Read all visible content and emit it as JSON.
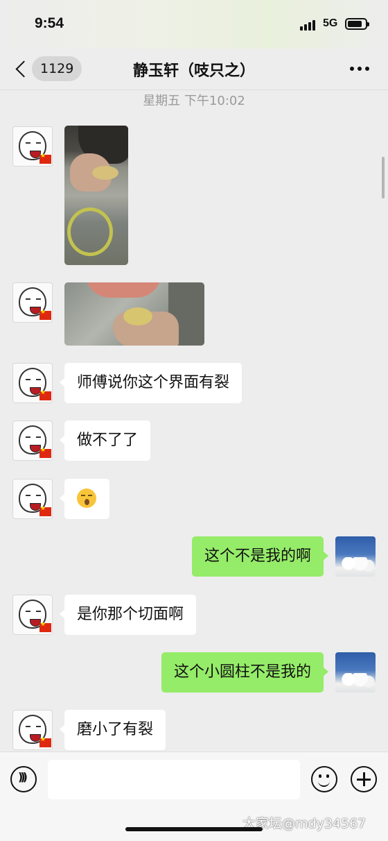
{
  "status_bar": {
    "time": "9:54",
    "network": "5G"
  },
  "nav": {
    "unread_count": "1129",
    "title": "静玉轩（吱只之）",
    "more_icon": "more-dots-icon",
    "back_icon": "chevron-left-icon"
  },
  "chat": {
    "timestamp": "星期五 下午10:02",
    "messages": [
      {
        "side": "left",
        "type": "image",
        "content": "photo"
      },
      {
        "side": "left",
        "type": "image",
        "content": "photo"
      },
      {
        "side": "left",
        "type": "text",
        "text": "师傅说你这个界面有裂"
      },
      {
        "side": "left",
        "type": "text",
        "text": "做不了了"
      },
      {
        "side": "left",
        "type": "emoji",
        "emoji": "astonished-face"
      },
      {
        "side": "right",
        "type": "text",
        "text": "这个不是我的啊"
      },
      {
        "side": "left",
        "type": "text",
        "text": "是你那个切面啊"
      },
      {
        "side": "right",
        "type": "text",
        "text": "这个小圆柱不是我的"
      },
      {
        "side": "left",
        "type": "text",
        "text": "磨小了有裂"
      }
    ]
  },
  "input_bar": {
    "voice_icon": "voice-icon",
    "text_value": "",
    "emoji_icon": "smiley-icon",
    "plus_icon": "plus-icon"
  },
  "watermark": "大家坛@mdy34567",
  "colors": {
    "background": "#ededed",
    "bubble_self": "#95ec69",
    "bubble_other": "#ffffff"
  }
}
